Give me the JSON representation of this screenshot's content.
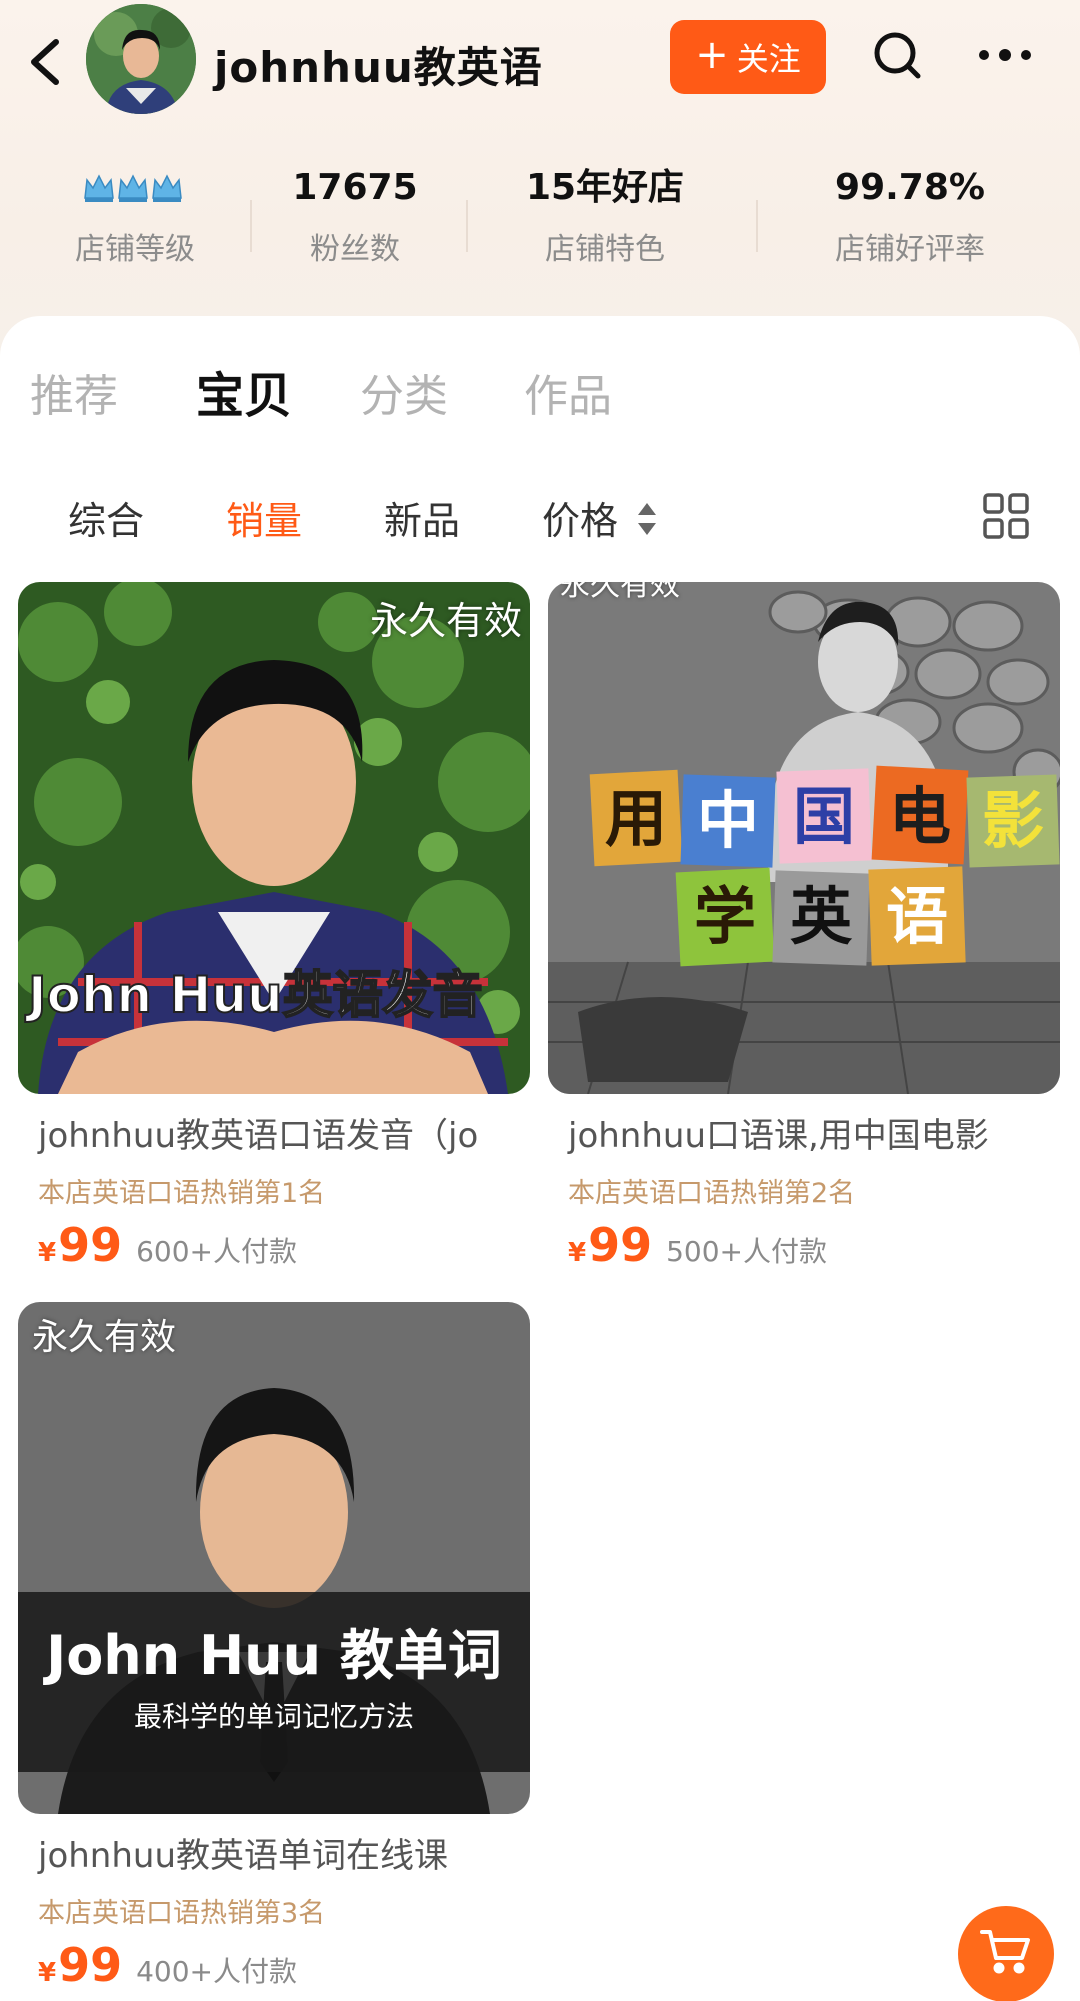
{
  "header": {
    "shop_name": "johnhuu教英语",
    "follow_label": "关注"
  },
  "stats": [
    {
      "value": "",
      "label": "店铺等级"
    },
    {
      "value": "17675",
      "label": "粉丝数"
    },
    {
      "value": "15年好店",
      "label": "店铺特色"
    },
    {
      "value": "99.78%",
      "label": "店铺好评率"
    }
  ],
  "tabs": [
    "推荐",
    "宝贝",
    "分类",
    "作品"
  ],
  "active_tab": "宝贝",
  "sort_options": [
    "综合",
    "销量",
    "新品",
    "价格"
  ],
  "active_sort": "销量",
  "colors": {
    "accent": "#ff5a16",
    "rank_text": "#c6996b"
  },
  "products": [
    {
      "badge": "永久有效",
      "cover_text": "John Huu英语发音",
      "title": "johnhuu教英语口语发音（jo",
      "rank": "本店英语口语热销第1名",
      "currency": "¥",
      "price": "99",
      "paid": "600+人付款"
    },
    {
      "badge": "永久有效",
      "cover_text": "用中国电影学英语",
      "title": "johnhuu口语课,用中国电影",
      "rank": "本店英语口语热销第2名",
      "currency": "¥",
      "price": "99",
      "paid": "500+人付款"
    },
    {
      "badge": "永久有效",
      "cover_text": "John Huu 教单词",
      "cover_subtext": "最科学的单词记忆方法",
      "title": "johnhuu教英语单词在线课",
      "rank": "本店英语口语热销第3名",
      "currency": "¥",
      "price": "99",
      "paid": "400+人付款"
    }
  ]
}
